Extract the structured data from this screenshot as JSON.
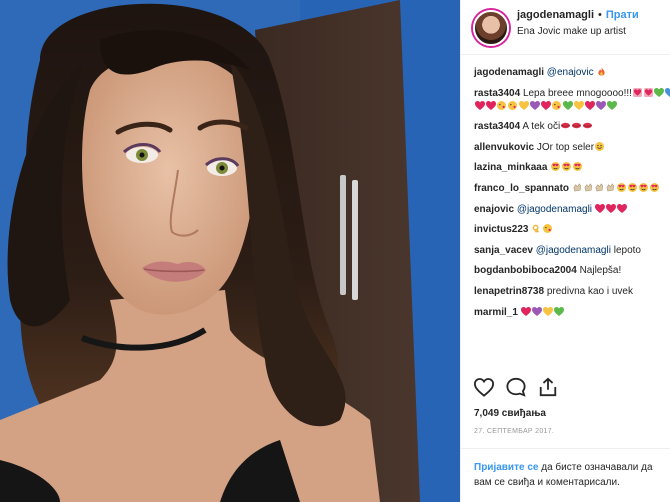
{
  "post": {
    "username": "jagodenamagli",
    "follow_label": "Прати",
    "location": "Ena Jovic make up artist"
  },
  "comments": [
    {
      "user": "jagodenamagli",
      "mention": "@enajovic",
      "text": "",
      "emoji": [
        "fire"
      ]
    },
    {
      "user": "rasta3404",
      "text": "Lepa breee mnogoooo!!!",
      "emoji": [
        "red-heart-face",
        "red-heart-face",
        "green-heart",
        "blue-heart",
        "red-heart",
        "red-heart",
        "kiss-face",
        "kiss-face",
        "yellow-heart",
        "purple-heart",
        "red-heart",
        "kiss-face",
        "green-heart",
        "yellow-heart",
        "red-heart",
        "purple-heart",
        "green-heart"
      ]
    },
    {
      "user": "rasta3404",
      "text": "A tek oči",
      "emoji": [
        "lips",
        "lips",
        "lips"
      ]
    },
    {
      "user": "allenvukovic",
      "text": "JOr top seler",
      "emoji": [
        "smile-face"
      ]
    },
    {
      "user": "lazina_minkaaa",
      "text": "",
      "emoji": [
        "heart-eyes",
        "heart-eyes",
        "heart-eyes"
      ]
    },
    {
      "user": "franco_lo_spannato",
      "text": "",
      "emoji": [
        "clap",
        "clap",
        "clap",
        "clap",
        "heart-eyes",
        "heart-eyes",
        "heart-eyes",
        "heart-eyes"
      ]
    },
    {
      "user": "enajovic",
      "mention": "@jagodenamagli",
      "text": "",
      "emoji": [
        "red-heart",
        "red-heart",
        "red-heart"
      ]
    },
    {
      "user": "invictus223",
      "text": "",
      "emoji": [
        "ok-hand",
        "kiss-face"
      ]
    },
    {
      "user": "sanja_vacev",
      "mention": "@jagodenamagli",
      "text": "lepoto",
      "emoji": []
    },
    {
      "user": "bogdanbobiboca2004",
      "text": "Najlepša!",
      "emoji": []
    },
    {
      "user": "lenapetrin8738",
      "text": "predivna kao i uvek",
      "emoji": []
    },
    {
      "user": "marmil_1",
      "text": "",
      "emoji": [
        "red-heart",
        "purple-heart",
        "yellow-heart",
        "green-heart"
      ]
    }
  ],
  "actions": {
    "like_icon": "heart-outline-icon",
    "comment_icon": "comment-bubble-icon",
    "share_icon": "share-upload-icon"
  },
  "likes": "7,049 свиђања",
  "date": "27. СЕПТЕМБАР 2017.",
  "login": {
    "link_label": "Пријавите се",
    "rest": " да бисте означавали да вам се свиђа и коментарисали."
  },
  "colors": {
    "link": "#3897f0",
    "mention": "#003569",
    "text": "#262626",
    "muted": "#999999",
    "wall_blue": "#2f6ab8"
  }
}
